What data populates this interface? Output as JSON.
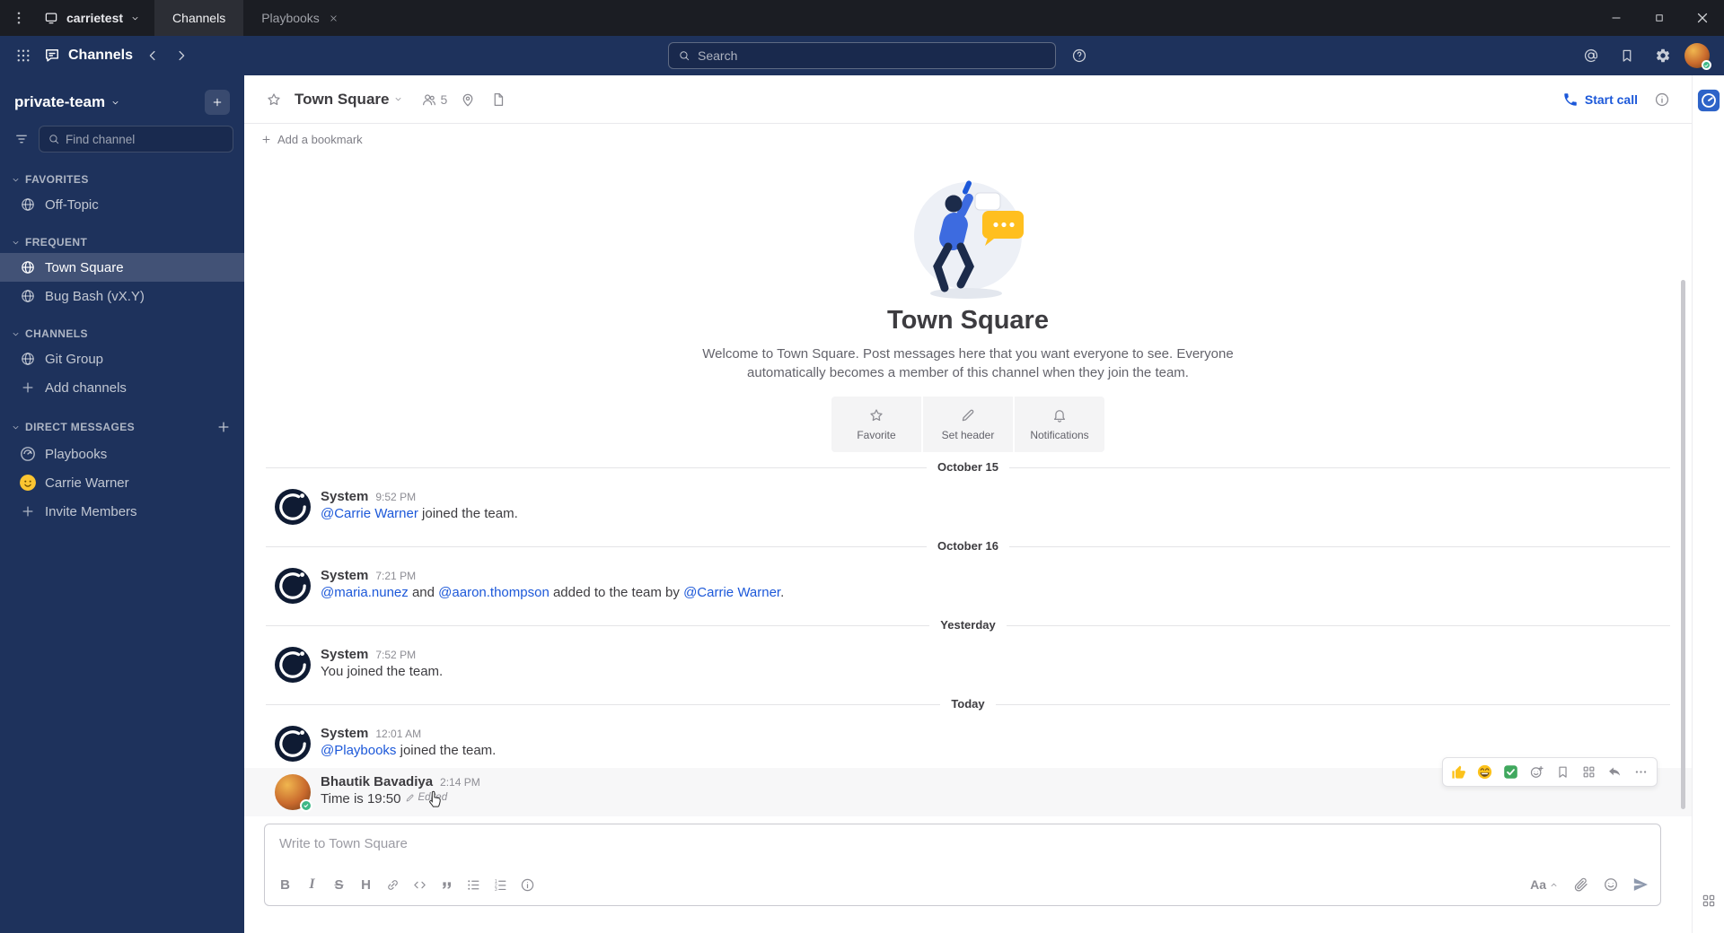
{
  "colors": {
    "accent": "#1c58d9",
    "sidebar_bg": "#1e325c",
    "titlebar_bg": "#1b1d23",
    "mention": "#1c58d9",
    "online_green": "#3db887"
  },
  "titlebar": {
    "server_name": "carrietest",
    "tabs": [
      {
        "label": "Channels",
        "active": true
      },
      {
        "label": "Playbooks",
        "active": false,
        "closable": true
      }
    ]
  },
  "global_header": {
    "product_name": "Channels",
    "search_placeholder": "Search"
  },
  "sidebar": {
    "team_name": "private-team",
    "find_placeholder": "Find channel",
    "sections": [
      {
        "label": "FAVORITES",
        "has_plus": false,
        "items": [
          {
            "label": "Off-Topic",
            "icon": "globe"
          }
        ]
      },
      {
        "label": "FREQUENT",
        "has_plus": false,
        "items": [
          {
            "label": "Town Square",
            "icon": "globe",
            "active": true
          },
          {
            "label": "Bug Bash (vX.Y)",
            "icon": "globe"
          }
        ]
      },
      {
        "label": "CHANNELS",
        "has_plus": false,
        "items": [
          {
            "label": "Git Group",
            "icon": "globe"
          },
          {
            "label": "Add channels",
            "icon": "plus"
          }
        ]
      },
      {
        "label": "DIRECT MESSAGES",
        "has_plus": true,
        "items": [
          {
            "label": "Playbooks",
            "icon": "playbooks-avatar"
          },
          {
            "label": "Carrie Warner",
            "icon": "carrie-avatar"
          },
          {
            "label": "Invite Members",
            "icon": "plus"
          }
        ]
      }
    ]
  },
  "channel_header": {
    "name": "Town Square",
    "member_count": "5",
    "start_call_label": "Start call"
  },
  "bookmarks_bar": {
    "add_label": "Add a bookmark"
  },
  "intro": {
    "title": "Town Square",
    "description": "Welcome to Town Square. Post messages here that you want everyone to see. Everyone automatically becomes a member of this channel when they join the team.",
    "actions": [
      {
        "label": "Favorite",
        "icon": "star"
      },
      {
        "label": "Set header",
        "icon": "pencil"
      },
      {
        "label": "Notifications",
        "icon": "bell"
      }
    ]
  },
  "timeline": [
    {
      "type": "divider",
      "label": "October 15"
    },
    {
      "type": "post",
      "author": "System",
      "time": "9:52 PM",
      "avatar": "system",
      "segments": [
        {
          "kind": "mention",
          "text": "@Carrie Warner"
        },
        {
          "kind": "text",
          "text": " joined the team."
        }
      ]
    },
    {
      "type": "divider",
      "label": "October 16"
    },
    {
      "type": "post",
      "author": "System",
      "time": "7:21 PM",
      "avatar": "system",
      "segments": [
        {
          "kind": "mention",
          "text": "@maria.nunez"
        },
        {
          "kind": "text",
          "text": " and "
        },
        {
          "kind": "mention",
          "text": "@aaron.thompson"
        },
        {
          "kind": "text",
          "text": " added to the team by "
        },
        {
          "kind": "mention",
          "text": "@Carrie Warner"
        },
        {
          "kind": "text",
          "text": "."
        }
      ]
    },
    {
      "type": "divider",
      "label": "Yesterday"
    },
    {
      "type": "post",
      "author": "System",
      "time": "7:52 PM",
      "avatar": "system",
      "segments": [
        {
          "kind": "text",
          "text": "You joined the team."
        }
      ]
    },
    {
      "type": "divider",
      "label": "Today"
    },
    {
      "type": "post",
      "author": "System",
      "time": "12:01 AM",
      "avatar": "system",
      "segments": [
        {
          "kind": "mention",
          "text": "@Playbooks"
        },
        {
          "kind": "text",
          "text": " joined the team."
        }
      ]
    },
    {
      "type": "post",
      "author": "Bhautik Bavadiya",
      "time": "2:14 PM",
      "avatar": "user",
      "hovered": true,
      "segments": [
        {
          "kind": "text",
          "text": "Time is 19:50"
        },
        {
          "kind": "edited",
          "text": "Edited"
        }
      ]
    }
  ],
  "hover_toolbar": {
    "quick_reactions": [
      {
        "name": "thumbsup",
        "icon": "emoji-thumbsup"
      },
      {
        "name": "smile",
        "icon": "emoji-grin"
      },
      {
        "name": "white-check-mark",
        "icon": "emoji-check"
      }
    ],
    "actions": [
      {
        "name": "add-reaction",
        "icon": "add-reaction"
      },
      {
        "name": "save-message",
        "icon": "flag-bookmark"
      },
      {
        "name": "message-actions",
        "icon": "apps"
      },
      {
        "name": "reply",
        "icon": "reply"
      },
      {
        "name": "more-actions",
        "icon": "dots-horizontal"
      }
    ]
  },
  "composer": {
    "placeholder": "Write to Town Square",
    "text_style_label": "Aa",
    "format_buttons": [
      {
        "name": "bold",
        "icon": "bold"
      },
      {
        "name": "italic",
        "icon": "italic"
      },
      {
        "name": "strikethrough",
        "icon": "strike"
      },
      {
        "name": "heading",
        "icon": "heading"
      },
      {
        "name": "link",
        "icon": "link"
      },
      {
        "name": "code",
        "icon": "code"
      },
      {
        "name": "quote",
        "icon": "quote"
      },
      {
        "name": "bulleted-list",
        "icon": "ul"
      },
      {
        "name": "numbered-list",
        "icon": "ol"
      },
      {
        "name": "help",
        "icon": "info"
      }
    ]
  }
}
